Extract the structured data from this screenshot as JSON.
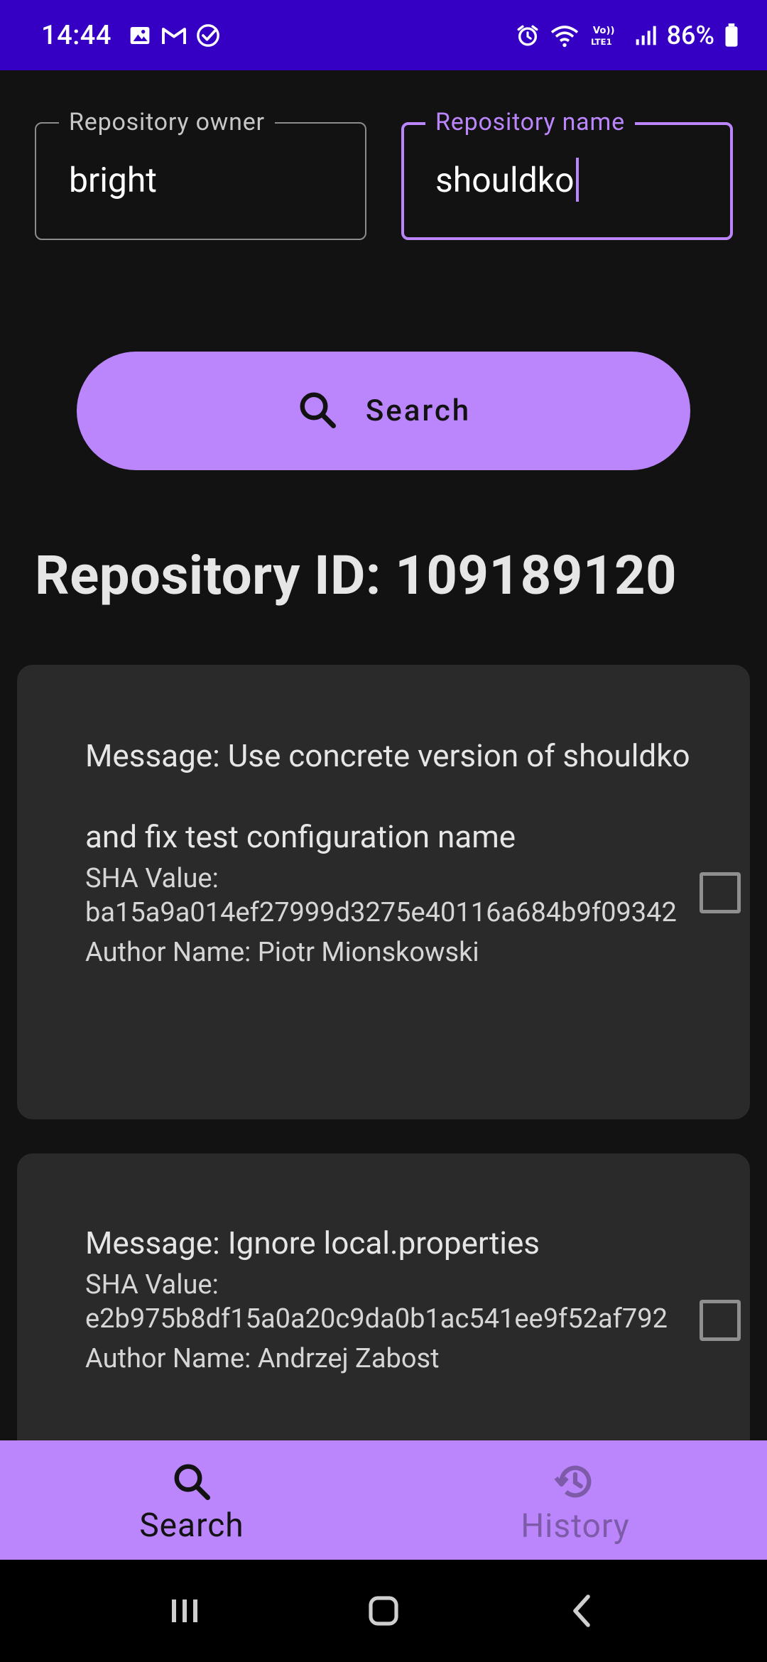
{
  "status_bar": {
    "time": "14:44",
    "battery": "86%",
    "left_icons": [
      "gallery-icon",
      "gmail-icon",
      "check-circle-icon"
    ],
    "right_icons": [
      "alarm-icon",
      "wifi-icon",
      "volte-icon",
      "signal-icon",
      "battery-icon"
    ]
  },
  "form": {
    "owner_label": "Repository owner",
    "owner_value": "bright",
    "name_label": "Repository name",
    "name_value": "shouldko"
  },
  "search_button": {
    "label": "Search"
  },
  "repository": {
    "id_text": "Repository ID: 109189120"
  },
  "commits": [
    {
      "message": "Message: Use concrete version of shouldko\n\n and fix test configuration name",
      "sha_label": "SHA Value:",
      "sha": "ba15a9a014ef27999d3275e40116a684b9f09342",
      "author": "Author Name: Piotr Mionskowski",
      "checked": false
    },
    {
      "message": "Message: Ignore local.properties",
      "sha_label": "SHA Value:",
      "sha": "e2b975b8df15a0a20c9da0b1ac541ee9f52af792",
      "author": "Author Name: Andrzej Zabost",
      "checked": false
    }
  ],
  "bottom_nav": {
    "items": [
      {
        "label": "Search",
        "icon": "search-icon",
        "active": true
      },
      {
        "label": "History",
        "icon": "history-icon",
        "active": false
      }
    ]
  },
  "colors": {
    "status_bar": "#3600c4",
    "accent": "#bb86fc",
    "background": "#121212",
    "card": "#2a2a2a"
  }
}
